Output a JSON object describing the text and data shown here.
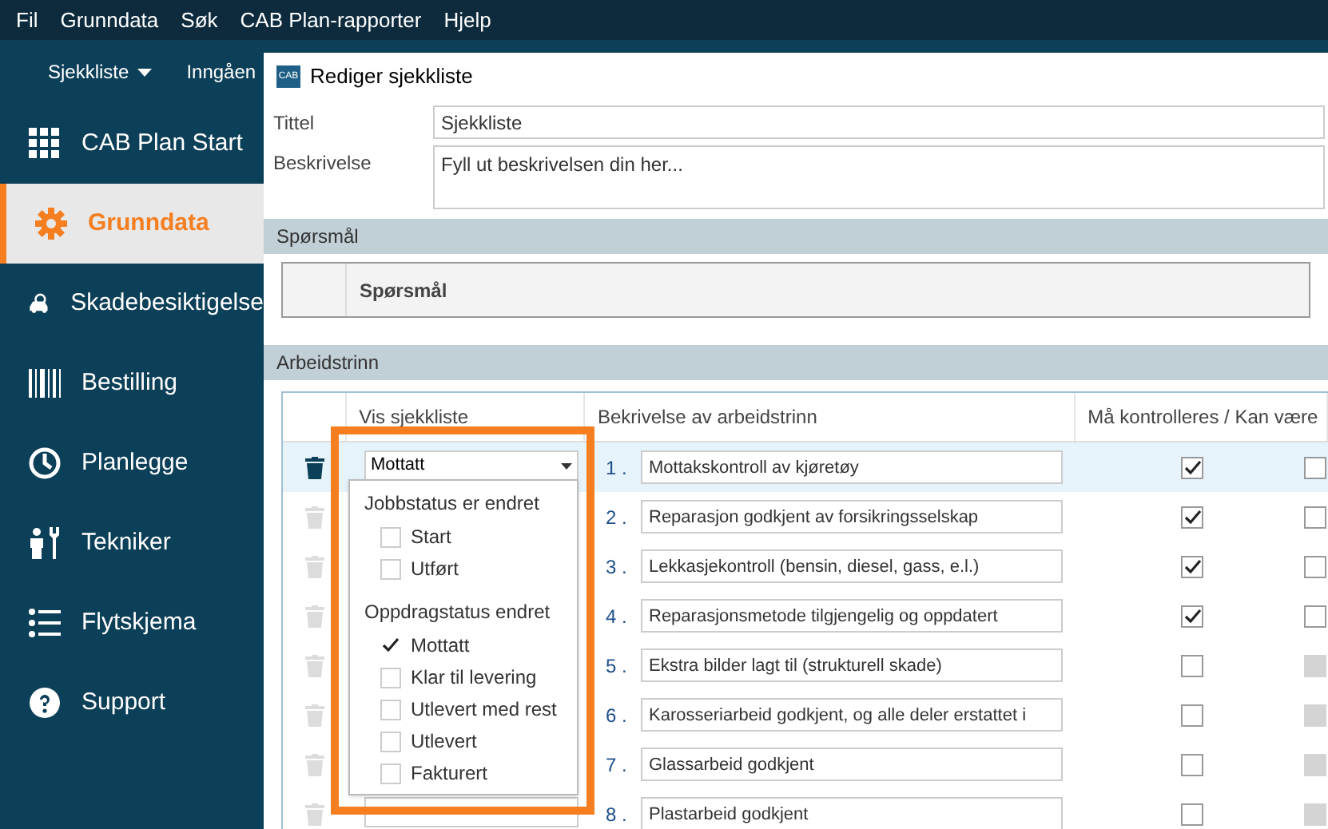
{
  "menu_bar": [
    "Fil",
    "Grunndata",
    "Søk",
    "CAB Plan-rapporter",
    "Hjelp"
  ],
  "toolbar": [
    {
      "label": "Sjekkliste",
      "dropdown": true
    },
    {
      "label": "Inngåen",
      "dropdown": false
    }
  ],
  "sidebar": {
    "items": [
      {
        "label": "CAB Plan Start",
        "selected": false
      },
      {
        "label": "Grunndata",
        "selected": true
      },
      {
        "label": "Skadebesiktigelse",
        "selected": false
      },
      {
        "label": "Bestilling",
        "selected": false
      },
      {
        "label": "Planlegge",
        "selected": false
      },
      {
        "label": "Tekniker",
        "selected": false
      },
      {
        "label": "Flytskjema",
        "selected": false
      },
      {
        "label": "Support",
        "selected": false
      }
    ]
  },
  "dialog": {
    "logo_text": "CAB",
    "title": "Rediger sjekkliste",
    "fields": [
      {
        "label": "Tittel",
        "value": "Sjekkliste",
        "kind": "input"
      },
      {
        "label": "Beskrivelse",
        "placeholder": "Fyll ut beskrivelsen din her...",
        "kind": "textarea"
      }
    ],
    "questions": {
      "header": "Spørsmål",
      "columns": [
        "Spørsmål"
      ]
    },
    "steps": {
      "header": "Arbeidstrinn",
      "columns": [
        "Vis sjekkliste",
        "Bekrivelse av arbeidstrinn",
        "Må kontrolleres / Kan være"
      ],
      "rows": [
        {
          "selected": true,
          "dropdown": true,
          "dropdown_value": "Mottatt",
          "number": "1 .",
          "description": "Mottakskontroll av kjøretøy",
          "must_check": true,
          "second_check": {
            "checked": false,
            "disabled": false
          }
        },
        {
          "selected": false,
          "dropdown": false,
          "number": "2 .",
          "description": "Reparasjon godkjent av forsikringsselskap",
          "must_check": true,
          "second_check": {
            "checked": false,
            "disabled": false
          }
        },
        {
          "selected": false,
          "dropdown": false,
          "number": "3 .",
          "description": "Lekkasjekontroll (bensin, diesel, gass, e.l.)",
          "must_check": true,
          "second_check": {
            "checked": false,
            "disabled": false
          }
        },
        {
          "selected": false,
          "dropdown": false,
          "number": "4 .",
          "description": "Reparasjonsmetode tilgjengelig og oppdatert",
          "must_check": true,
          "second_check": {
            "checked": false,
            "disabled": false
          }
        },
        {
          "selected": false,
          "dropdown": false,
          "number": "5 .",
          "description": "Ekstra bilder lagt til (strukturell skade)",
          "must_check": false,
          "second_check": {
            "checked": false,
            "disabled": true
          }
        },
        {
          "selected": false,
          "dropdown": false,
          "number": "6 .",
          "description": "Karosseriarbeid godkjent, og alle deler erstattet i",
          "must_check": false,
          "second_check": {
            "checked": false,
            "disabled": true
          }
        },
        {
          "selected": false,
          "dropdown": false,
          "number": "7 .",
          "description": "Glassarbeid godkjent",
          "must_check": false,
          "second_check": {
            "checked": false,
            "disabled": true
          }
        },
        {
          "selected": false,
          "dropdown": true,
          "dropdown_value": "",
          "number": "8 .",
          "description": "Plastarbeid godkjent",
          "must_check": false,
          "second_check": {
            "checked": false,
            "disabled": true
          }
        }
      ]
    },
    "dropdown_popup": {
      "highlighted": true,
      "groups": [
        {
          "heading": "Jobbstatus er endret",
          "options": [
            {
              "label": "Start",
              "checked": false
            },
            {
              "label": "Utført",
              "checked": false
            }
          ]
        },
        {
          "heading": "Oppdragstatus endret",
          "options": [
            {
              "label": "Mottatt",
              "checked": true
            },
            {
              "label": "Klar til levering",
              "checked": false
            },
            {
              "label": "Utlevert med rest",
              "checked": false
            },
            {
              "label": "Utlevert",
              "checked": false
            },
            {
              "label": "Fakturert",
              "checked": false
            }
          ]
        }
      ]
    }
  }
}
